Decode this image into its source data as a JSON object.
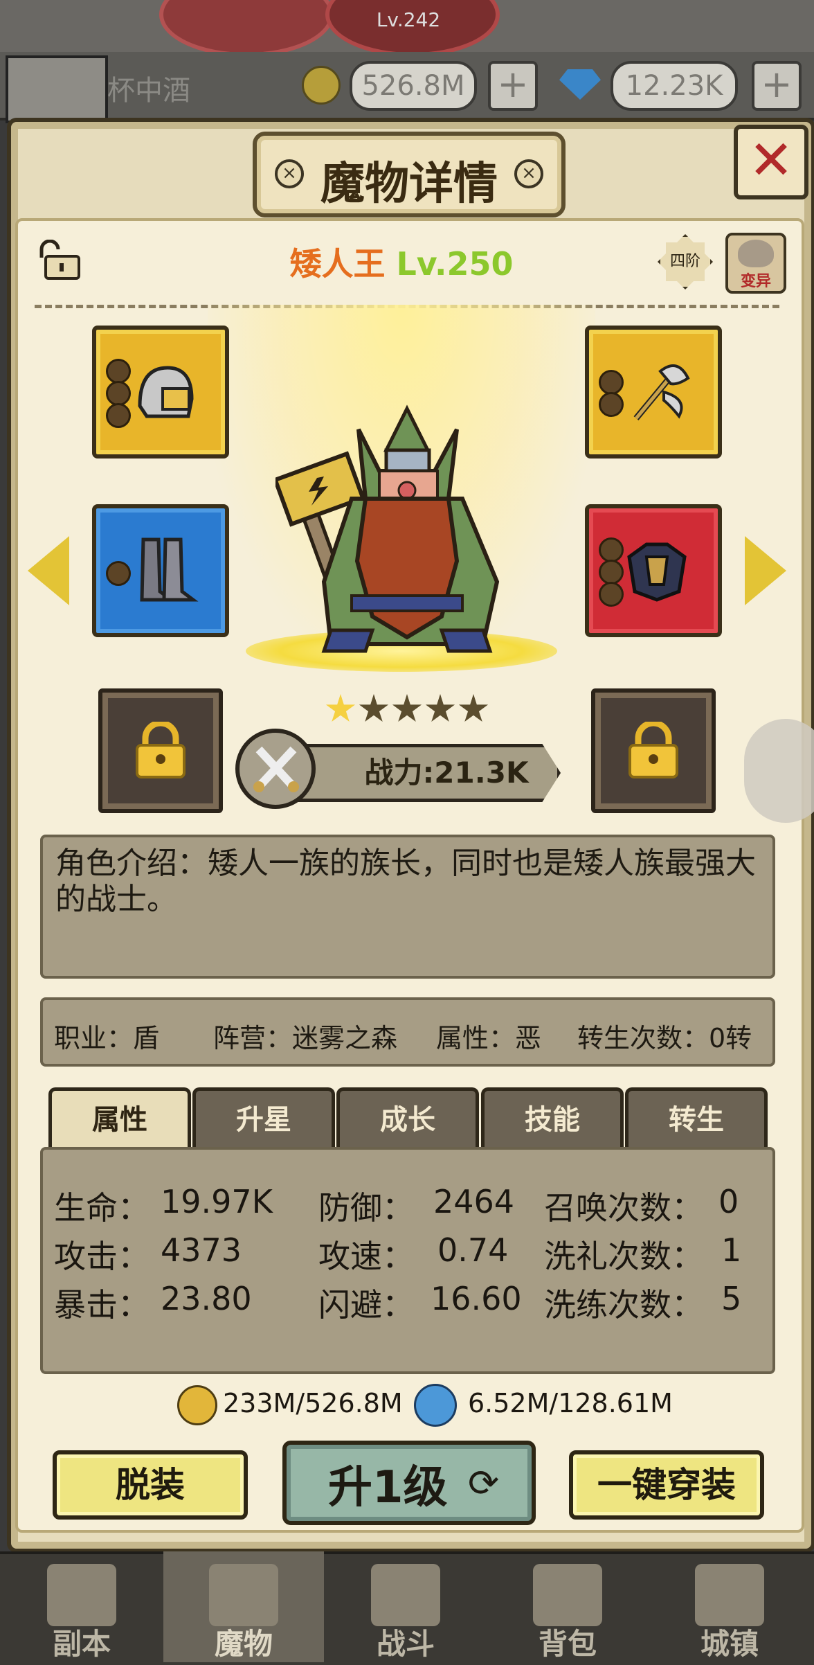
{
  "topbar": {
    "level": "Lv.242",
    "player_name": "杯中酒",
    "gold": "526.8M",
    "gems": "12.23K",
    "plus": "+"
  },
  "panel": {
    "title": "魔物详情",
    "close": "✕"
  },
  "monster": {
    "name": "矮人王",
    "level": "Lv.250",
    "tier": "四阶",
    "mutate": "变异",
    "stars_filled": 1,
    "stars_total": 5,
    "power": "战力:21.3K"
  },
  "description": "角色介绍：矮人一族的族长，同时也是矮人族最强大的战士。",
  "info": {
    "job": "职业：盾",
    "camp": "阵营：迷雾之森",
    "attr": "属性：恶",
    "rebirth": "转生次数：0转"
  },
  "tabs": [
    "属性",
    "升星",
    "成长",
    "技能",
    "转生"
  ],
  "stats": {
    "hp_label": "生命：",
    "hp": "19.97K",
    "def_label": "防御：",
    "def": "2464",
    "summon_label": "召唤次数：",
    "summon": "0",
    "atk_label": "攻击：",
    "atk": "4373",
    "aspd_label": "攻速：",
    "aspd": "0.74",
    "baptize_label": "洗礼次数：",
    "baptize": "1",
    "crit_label": "暴击：",
    "crit": "23.80",
    "dodge_label": "闪避：",
    "dodge": "16.60",
    "refine_label": "洗练次数：",
    "refine": "5"
  },
  "costs": {
    "gold": "233M/526.8M",
    "soul": "6.52M/128.61M"
  },
  "buttons": {
    "unequip": "脱装",
    "levelup": "升1级",
    "equip_all": "一键穿装"
  },
  "nav": [
    {
      "label": "副本",
      "icon": "map-icon"
    },
    {
      "label": "魔物",
      "icon": "helmet-icon"
    },
    {
      "label": "战斗",
      "icon": "swords-icon"
    },
    {
      "label": "背包",
      "icon": "backpack-icon"
    },
    {
      "label": "城镇",
      "icon": "castle-icon"
    }
  ],
  "colors": {
    "name": "#e56e1e",
    "level": "#8cc82c",
    "close": "#b12a2a",
    "slot_gold": "#e8b52a",
    "slot_blue": "#2b7bd0",
    "slot_red": "#d02c36"
  }
}
